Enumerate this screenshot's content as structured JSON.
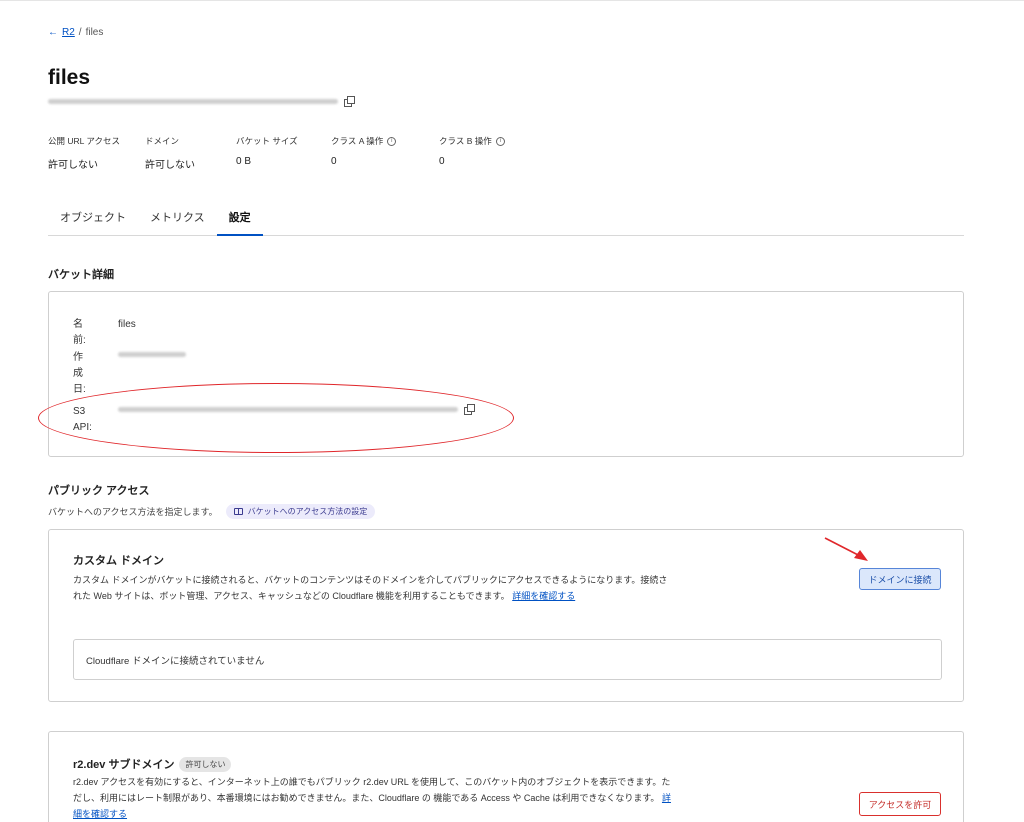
{
  "breadcrumb": {
    "back_arrow": "←",
    "parent": "R2",
    "separator": "/",
    "current": "files"
  },
  "page": {
    "title": "files"
  },
  "stats": [
    {
      "label": "公開 URL アクセス",
      "value": "許可しない",
      "info": false
    },
    {
      "label": "ドメイン",
      "value": "許可しない",
      "info": false
    },
    {
      "label": "バケット サイズ",
      "value": "0 B",
      "info": false
    },
    {
      "label": "クラス A 操作",
      "value": "0",
      "info": true
    },
    {
      "label": "クラス B 操作",
      "value": "0",
      "info": true
    }
  ],
  "tabs": [
    "オブジェクト",
    "メトリクス",
    "設定"
  ],
  "active_tab": "設定",
  "bucket_details": {
    "title": "バケット詳細",
    "name_label": "名前:",
    "name_value": "files",
    "created_label": "作成日:",
    "s3_label": "S3 API:"
  },
  "public_access": {
    "title": "パブリック アクセス",
    "description": "バケットへのアクセス方法を指定します。",
    "help_pill": "バケットへのアクセス方法の設定"
  },
  "custom_domain": {
    "title": "カスタム ドメイン",
    "text": "カスタム ドメインがバケットに接続されると、バケットのコンテンツはそのドメインを介してパブリックにアクセスできるようになります。接続された Web サイトは、ボット管理、アクセス、キャッシュなどの Cloudflare 機能を利用することもできます。",
    "link": "詳細を確認する",
    "connect_button": "ドメインに接続",
    "empty_state": "Cloudflare ドメインに接続されていません"
  },
  "r2dev": {
    "title": "r2.dev サブドメイン",
    "badge": "許可しない",
    "text": "r2.dev アクセスを有効にすると、インターネット上の誰でもパブリック r2.dev URL を使用して、このバケット内のオブジェクトを表示できます。ただし、利用にはレート制限があり、本番環境にはお勧めできません。また、Cloudflare の 機能である Access や Cache は利用できなくなります。",
    "link": "詳細を確認する",
    "allow_button": "アクセスを許可"
  },
  "colors": {
    "accent": "#0051c3",
    "annotation": "#e0272b",
    "danger": "#d9302d"
  },
  "icons": {
    "copy": "copy-icon",
    "info": "info-icon",
    "book": "book-icon"
  }
}
